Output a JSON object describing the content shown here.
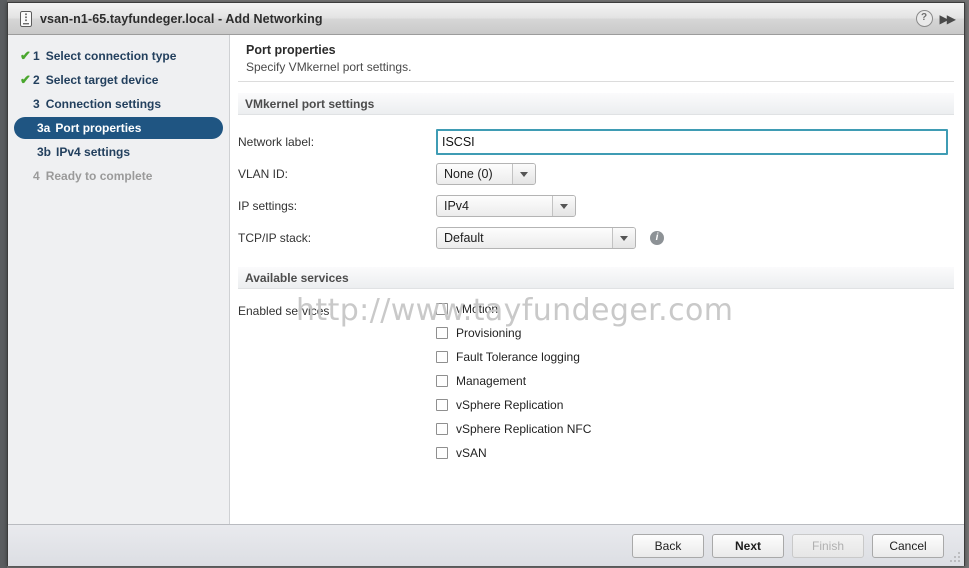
{
  "window": {
    "title": "vsan-n1-65.tayfundeger.local - Add Networking",
    "host_icon": "host-icon",
    "help_icon": "?",
    "expand_icon": "▶▶"
  },
  "sidebar": {
    "steps": [
      {
        "check": "✔",
        "num": "1",
        "label": "Select connection type",
        "state": "done",
        "sub": false
      },
      {
        "check": "✔",
        "num": "2",
        "label": "Select target device",
        "state": "done",
        "sub": false
      },
      {
        "check": "",
        "num": "3",
        "label": "Connection settings",
        "state": "current",
        "sub": false
      },
      {
        "check": "",
        "num": "3a",
        "label": "Port properties",
        "state": "selected",
        "sub": true
      },
      {
        "check": "",
        "num": "3b",
        "label": "IPv4 settings",
        "state": "normal",
        "sub": true
      },
      {
        "check": "",
        "num": "4",
        "label": "Ready to complete",
        "state": "muted",
        "sub": false
      }
    ]
  },
  "content": {
    "title": "Port properties",
    "subtitle": "Specify VMkernel port settings.",
    "sections": {
      "vmkernel": "VMkernel port settings",
      "services": "Available services"
    },
    "fields": {
      "network_label": {
        "label": "Network label:",
        "value": "ISCSI",
        "placeholder": ""
      },
      "vlan_id": {
        "label": "VLAN ID:",
        "value": "None (0)"
      },
      "ip_settings": {
        "label": "IP settings:",
        "value": "IPv4"
      },
      "tcpip_stack": {
        "label": "TCP/IP stack:",
        "value": "Default",
        "info_icon": "i"
      }
    },
    "services": {
      "label": "Enabled services:",
      "items": [
        {
          "label": "vMotion",
          "checked": false
        },
        {
          "label": "Provisioning",
          "checked": false
        },
        {
          "label": "Fault Tolerance logging",
          "checked": false
        },
        {
          "label": "Management",
          "checked": false
        },
        {
          "label": "vSphere Replication",
          "checked": false
        },
        {
          "label": "vSphere Replication NFC",
          "checked": false
        },
        {
          "label": "vSAN",
          "checked": false
        }
      ]
    },
    "watermark": "http://www.tayfundeger.com"
  },
  "footer": {
    "back": "Back",
    "next": "Next",
    "finish": "Finish",
    "cancel": "Cancel"
  },
  "colors": {
    "selected_step": "#1f5582",
    "check_green": "#4aa72e",
    "focus_border": "#3f9cb4",
    "sidebar_bg": "#eff0f2"
  }
}
